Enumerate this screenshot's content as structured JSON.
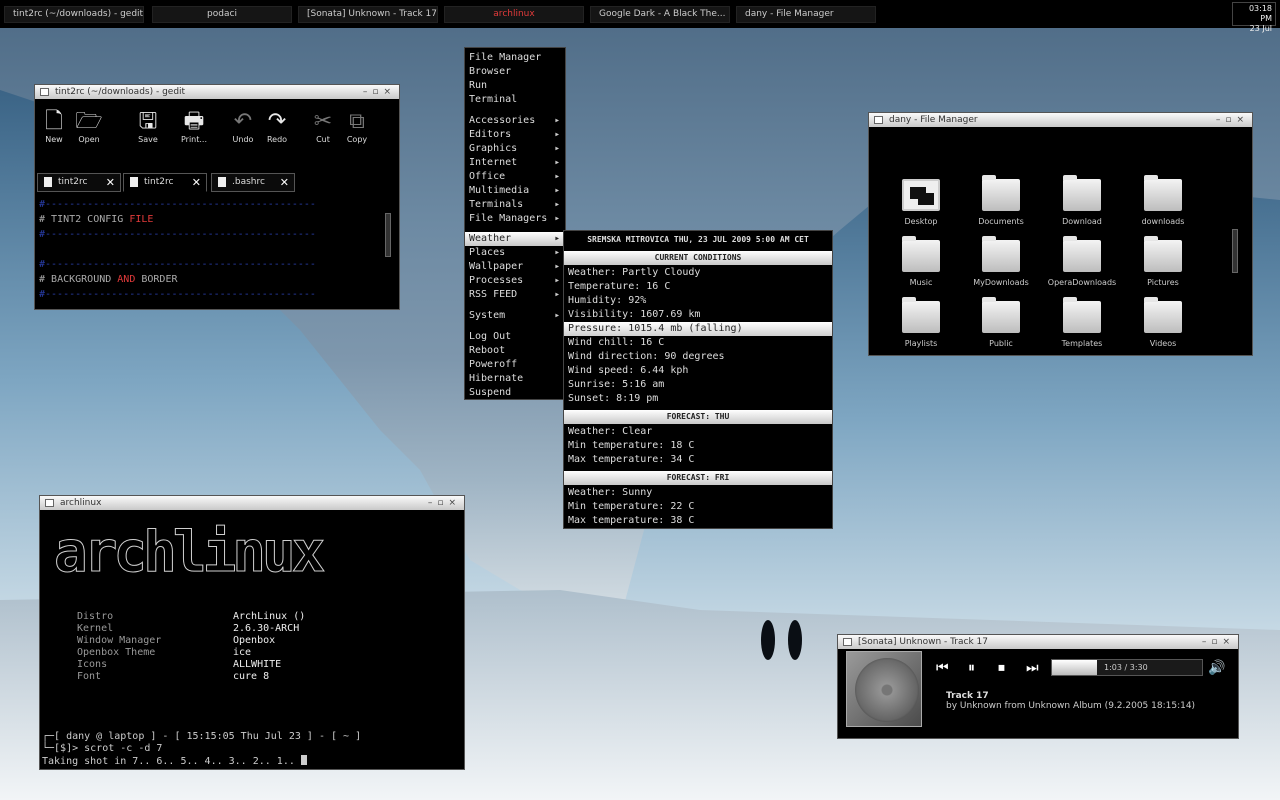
{
  "taskbar": {
    "tasks": [
      {
        "label": "tint2rc (~/downloads) - gedit"
      },
      {
        "label": "podaci"
      },
      {
        "label": "[Sonata] Unknown - Track 17"
      },
      {
        "label": "archlinux"
      },
      {
        "label": "Google Dark - A Black The..."
      },
      {
        "label": "dany - File Manager"
      }
    ],
    "clock": {
      "time": "03:18 PM",
      "date": "23 Jul"
    }
  },
  "gedit": {
    "title": "tint2rc (~/downloads) - gedit",
    "toolbar": {
      "new": "New",
      "open": "Open",
      "save": "Save",
      "print": "Print...",
      "undo": "Undo",
      "redo": "Redo",
      "cut": "Cut",
      "copy": "Copy"
    },
    "tabs": [
      "tint2rc",
      "tint2rc",
      ".bashrc"
    ],
    "code": {
      "dash": "#---------------------------------------------",
      "hash": "#",
      "line1_a": " TINT2 CONFIG ",
      "line1_b": "FILE",
      "line2_a": " BACKGROUND ",
      "line2_b": "AND",
      "line2_c": " BORDER"
    }
  },
  "menu": {
    "items": [
      "File Manager",
      "Browser",
      "Run",
      "Terminal"
    ],
    "submenus": [
      "Accessories",
      "Editors",
      "Graphics",
      "Internet",
      "Office",
      "Multimedia",
      "Terminals",
      "File Managers"
    ],
    "submenus2": [
      "Weather",
      "Places",
      "Wallpaper",
      "Processes",
      "RSS FEED"
    ],
    "system": "System",
    "power": [
      "Log Out",
      "Reboot",
      "Poweroff",
      "Hibernate",
      "Suspend"
    ]
  },
  "weather": {
    "header": "SREMSKA MITROVICA THU, 23 JUL 2009 5:00 AM CET",
    "current_title": "CURRENT CONDITIONS",
    "current": [
      "Weather: Partly Cloudy",
      "Temperature: 16 C",
      "Humidity: 92%",
      "Visibility: 1607.69 km",
      "Pressure: 1015.4 mb (falling)",
      "Wind chill: 16 C",
      "Wind direction: 90 degrees",
      "Wind speed: 6.44 kph",
      "Sunrise: 5:16 am",
      "Sunset: 8:19 pm"
    ],
    "thu_title": "FORECAST: THU",
    "thu": [
      "Weather: Clear",
      "Min temperature: 18 C",
      "Max temperature: 34 C"
    ],
    "fri_title": "FORECAST: FRI",
    "fri": [
      "Weather: Sunny",
      "Min temperature: 22 C",
      "Max temperature: 38 C"
    ]
  },
  "file_manager": {
    "title": "dany - File Manager",
    "items": [
      "Desktop",
      "Documents",
      "Download",
      "downloads",
      "Music",
      "MyDownloads",
      "OperaDownloads",
      "Pictures",
      "Playlists",
      "Public",
      "Templates",
      "Videos"
    ]
  },
  "terminal": {
    "title": "archlinux",
    "ascii_a": "arch",
    "ascii_b": "linux",
    "info": [
      {
        "k": "Distro",
        "v": "ArchLinux  ()"
      },
      {
        "k": "Kernel",
        "v": "2.6.30-ARCH"
      },
      {
        "k": "Window Manager",
        "v": "Openbox"
      },
      {
        "k": "Openbox Theme",
        "v": "ice"
      },
      {
        "k": "Icons",
        "v": "ALLWHITE"
      },
      {
        "k": "Font",
        "v": "cure 8"
      }
    ],
    "prompt1": "┌─[ dany @ laptop ] - [ 15:15:05 Thu Jul 23 ] - [ ~ ]",
    "prompt2": "└─[$]> scrot -c -d 7",
    "output": "Taking shot in 7.. 6.. 5.. 4.. 3.. 2.. 1.. "
  },
  "sonata": {
    "title": "[Sonata] Unknown - Track 17",
    "time": "1:03  /  3:30",
    "progress": 0.3,
    "track": "Track 17",
    "details": "by Unknown from Unknown Album (9.2.2005 18:15:14)"
  }
}
